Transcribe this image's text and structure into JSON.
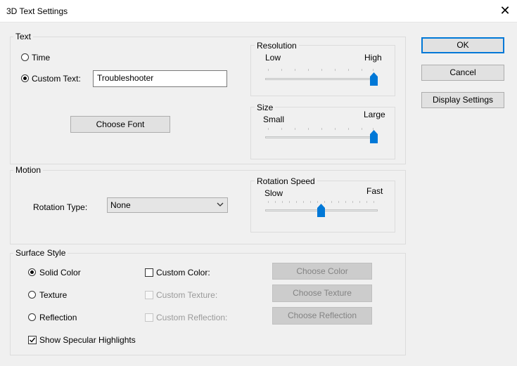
{
  "window": {
    "title": "3D Text Settings"
  },
  "text_group": {
    "label": "Text",
    "time_label": "Time",
    "custom_text_label": "Custom Text:",
    "custom_text_value": "Troubleshooter",
    "selected": "custom",
    "choose_font_label": "Choose Font"
  },
  "resolution": {
    "label": "Resolution",
    "min_label": "Low",
    "max_label": "High",
    "value_fraction": 1.0
  },
  "size": {
    "label": "Size",
    "min_label": "Small",
    "max_label": "Large",
    "value_fraction": 1.0
  },
  "motion": {
    "label": "Motion",
    "rotation_type_label": "Rotation Type:",
    "rotation_type_value": "None"
  },
  "rotation_speed": {
    "label": "Rotation Speed",
    "min_label": "Slow",
    "max_label": "Fast",
    "value_fraction": 0.5
  },
  "surface": {
    "label": "Surface Style",
    "solid_color_label": "Solid Color",
    "texture_label": "Texture",
    "reflection_label": "Reflection",
    "selected": "solid",
    "custom_color_label": "Custom Color:",
    "custom_texture_label": "Custom Texture:",
    "custom_reflection_label": "Custom Reflection:",
    "choose_color_label": "Choose Color",
    "choose_texture_label": "Choose Texture",
    "choose_reflection_label": "Choose Reflection",
    "specular_label": "Show Specular Highlights",
    "specular_checked": true
  },
  "buttons": {
    "ok": "OK",
    "cancel": "Cancel",
    "display_settings": "Display Settings"
  },
  "colors": {
    "accent": "#0078d7"
  },
  "icons": {
    "close": "close-icon",
    "dropdown": "chevron-down-icon",
    "check": "check-icon"
  }
}
